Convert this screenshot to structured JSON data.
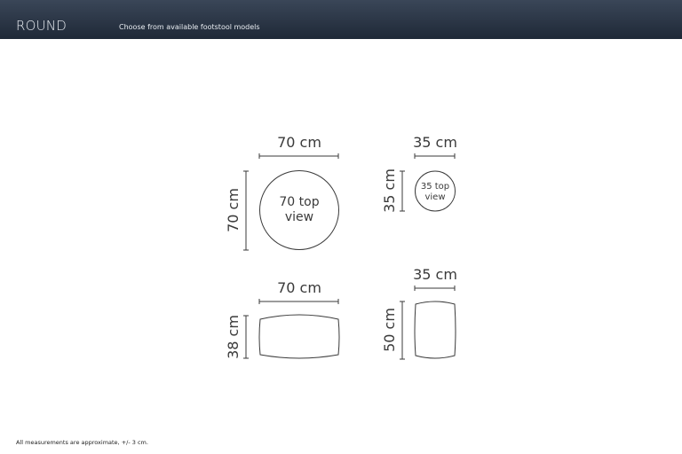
{
  "header": {
    "title": "ROUND",
    "subtitle": "Choose from available footstool models"
  },
  "models": {
    "large_top": {
      "width_label": "70 cm",
      "height_label": "70 cm",
      "inner_line1": "70 top",
      "inner_line2": "view"
    },
    "small_top": {
      "width_label": "35 cm",
      "height_label": "35 cm",
      "inner_line1": "35 top",
      "inner_line2": "view"
    },
    "large_side": {
      "width_label": "70 cm",
      "height_label": "38 cm"
    },
    "small_side": {
      "width_label": "35 cm",
      "height_label": "50 cm"
    }
  },
  "footer": {
    "note": "All measurements are approximate, +/- 3 cm."
  },
  "colors": {
    "header_top": "#3a4658",
    "header_bottom": "#1f2937",
    "line": "#3a3a3a"
  }
}
